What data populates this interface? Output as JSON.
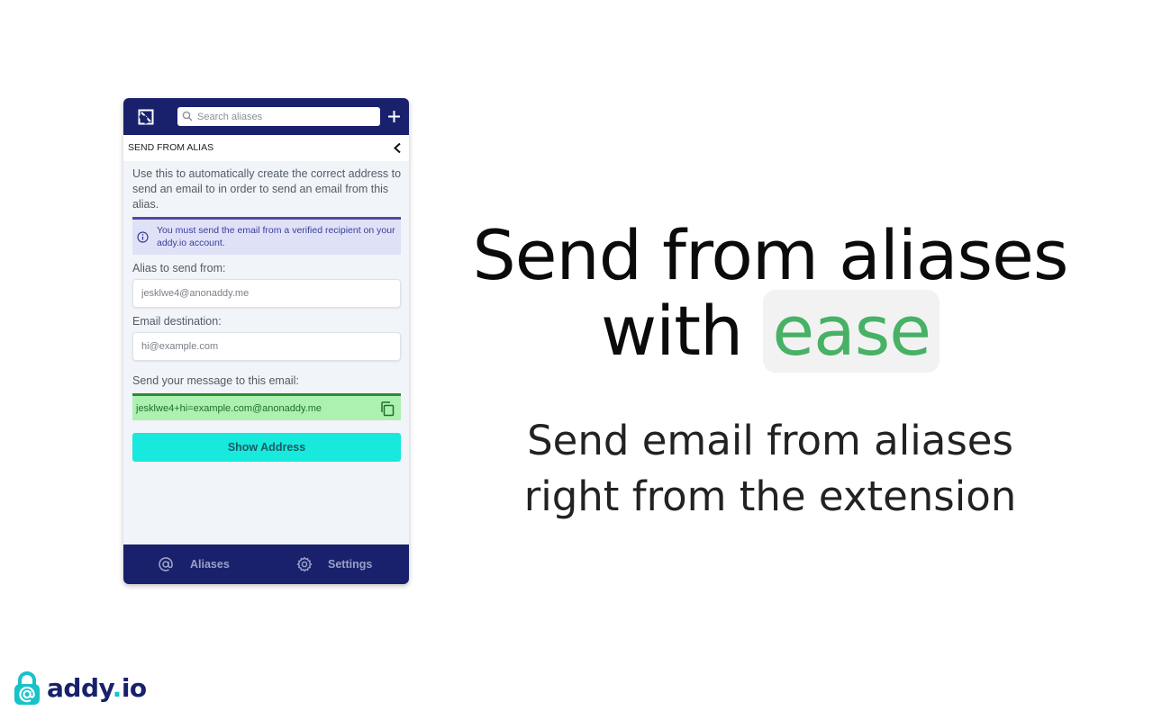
{
  "popup": {
    "search": {
      "placeholder": "Search aliases"
    },
    "subheader": {
      "title": "SEND FROM ALIAS"
    },
    "description": "Use this to automatically create the correct address to send an email to in order to send an email from this alias.",
    "notice": "You must send the email from a verified recipient on your addy.io account.",
    "alias_label": "Alias to send from:",
    "alias_placeholder": "jesklwe4@anonaddy.me",
    "destination_label": "Email destination:",
    "destination_placeholder": "hi@example.com",
    "result_label": "Send your message to this email:",
    "result_value": "jesklwe4+hi=example.com@anonaddy.me",
    "show_button": "Show Address",
    "nav": {
      "aliases": "Aliases",
      "settings": "Settings"
    }
  },
  "headline": {
    "line1": "Send from aliases",
    "line2_prefix": "with",
    "line2_highlight": "ease"
  },
  "subheadline": {
    "line1": "Send email from aliases",
    "line2": "right from the extension"
  },
  "brand": {
    "name_a": "addy",
    "name_dot": ".",
    "name_b": "io"
  },
  "colors": {
    "navy": "#19216c",
    "accent_teal": "#17e9dc",
    "success_green": "#adf1b1",
    "highlight_green": "#47b166"
  }
}
